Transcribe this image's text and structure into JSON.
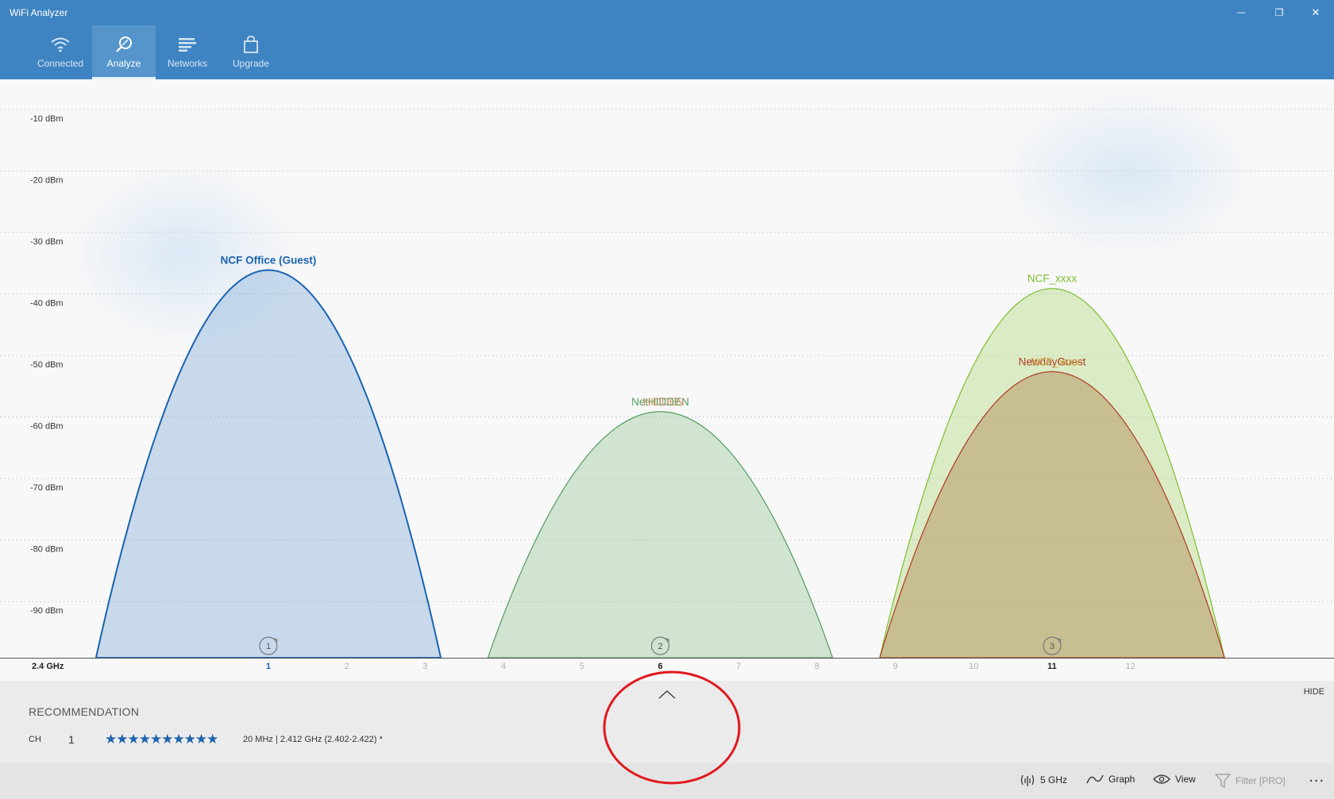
{
  "window": {
    "title": "WiFi Analyzer",
    "minimize": "—",
    "restore": "❐",
    "close": "✕"
  },
  "nav": {
    "items": [
      {
        "label": "Connected",
        "icon": "wifi-icon",
        "active": false
      },
      {
        "label": "Analyze",
        "icon": "analyze-icon",
        "active": true
      },
      {
        "label": "Networks",
        "icon": "networks-icon",
        "active": false
      },
      {
        "label": "Upgrade",
        "icon": "upgrade-icon",
        "active": false
      }
    ]
  },
  "chart_data": {
    "type": "area",
    "band_label": "2.4 GHz",
    "ylabels": [
      "-10 dBm",
      "-20 dBm",
      "-30 dBm",
      "-40 dBm",
      "-50 dBm",
      "-60 dBm",
      "-70 dBm",
      "-80 dBm",
      "-90 dBm"
    ],
    "ylim": [
      -99,
      -5
    ],
    "xlim": [
      -2,
      16
    ],
    "channel_ticks": [
      1,
      2,
      3,
      4,
      5,
      6,
      7,
      8,
      9,
      10,
      11,
      12
    ],
    "highlight_channels": [
      1,
      6,
      11
    ],
    "grid": true,
    "networks": [
      {
        "name": "NCF Office (Guest)",
        "channel": 1,
        "signal": -36,
        "color": "#1a64b0",
        "fill": "rgba(120,165,215,0.38)",
        "bold": true
      },
      {
        "name": "NetHIDDEN",
        "channel": 6,
        "signal": -59,
        "color": "#4f9d5b",
        "fill": "rgba(142,190,140,0.36)",
        "bold": false
      },
      {
        "name": "NCF_xxxx",
        "channel": 11,
        "signal": -39,
        "color": "#7bbf2e",
        "fill": "rgba(175,215,120,0.40)",
        "bold": false
      },
      {
        "name": "NewdayGuest",
        "channel": 11,
        "signal": -52.5,
        "color": "#b03a22",
        "fill": "rgba(185,160,110,0.60)",
        "bold": false
      }
    ],
    "overlap_labels": [
      {
        "text": "HIDDEN",
        "channel": 6,
        "signal": -59,
        "color": "#c98a50"
      },
      {
        "text": "NCF_xxxx",
        "channel": 11,
        "signal": -52.5,
        "color": "#c9a43a"
      }
    ],
    "channel_counts": [
      {
        "channel": 1,
        "count": "1"
      },
      {
        "channel": 6,
        "count": "2"
      },
      {
        "channel": 11,
        "count": "3"
      }
    ]
  },
  "recommendation": {
    "title": "RECOMMENDATION",
    "hide_label": "HIDE",
    "ch_label": "CH",
    "ch_value": "1",
    "stars": "★★★★★★★★★★",
    "rating": 10,
    "freq_info": "20 MHz | 2.412 GHz  (2.402-2.422)  *"
  },
  "commands": {
    "band": "5 GHz",
    "graph": "Graph",
    "view": "View",
    "filter": "Filter [PRO]",
    "more": "..."
  },
  "colors": {
    "titlebar": "#3f84c2",
    "accent": "#1a64b0",
    "annotation": "#e0191f"
  }
}
